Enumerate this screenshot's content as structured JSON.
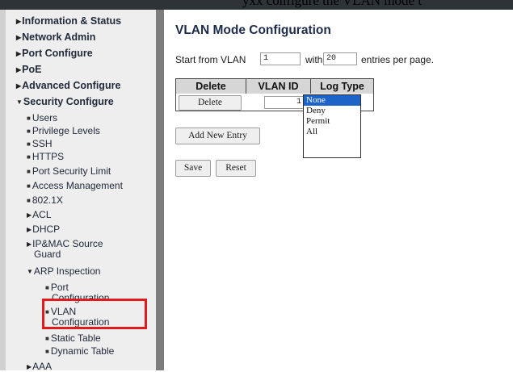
{
  "caption_fragment": "yxx configure the VLAN mode t",
  "sidebar": {
    "items": [
      {
        "label": "Information & Status"
      },
      {
        "label": "Network Admin"
      },
      {
        "label": "Port Configure"
      },
      {
        "label": "PoE"
      },
      {
        "label": "Advanced Configure"
      },
      {
        "label": "Security Configure"
      },
      {
        "label": "Users"
      },
      {
        "label": "Privilege Levels"
      },
      {
        "label": "SSH"
      },
      {
        "label": "HTTPS"
      },
      {
        "label": "Port Security Limit"
      },
      {
        "label": "Access Management"
      },
      {
        "label": "802.1X"
      },
      {
        "label": "ACL"
      },
      {
        "label": "DHCP"
      },
      {
        "label": "IP&MAC Source"
      },
      {
        "label": "Guard"
      },
      {
        "label": "ARP Inspection"
      },
      {
        "label": "Port"
      },
      {
        "label": "Configuration"
      },
      {
        "label": "VLAN"
      },
      {
        "label": "Configuration"
      },
      {
        "label": "Static Table"
      },
      {
        "label": "Dynamic Table"
      },
      {
        "label": "AAA"
      }
    ],
    "highlight_color": "#e01b1b"
  },
  "main": {
    "title": "VLAN Mode Configuration",
    "paging": {
      "start_label": "Start from VLAN",
      "start_value": "1",
      "with_label": "with",
      "count_value": "20",
      "suffix": "entries per page."
    },
    "table": {
      "headers": [
        "Delete",
        "VLAN ID",
        "Log Type"
      ],
      "row": {
        "delete_label": "Delete",
        "vlan_id": "1"
      }
    },
    "log_type": {
      "options": [
        "None",
        "Deny",
        "Permit",
        "All"
      ],
      "selected": "None"
    },
    "add_label": "Add New Entry",
    "save_label": "Save",
    "reset_label": "Reset"
  }
}
